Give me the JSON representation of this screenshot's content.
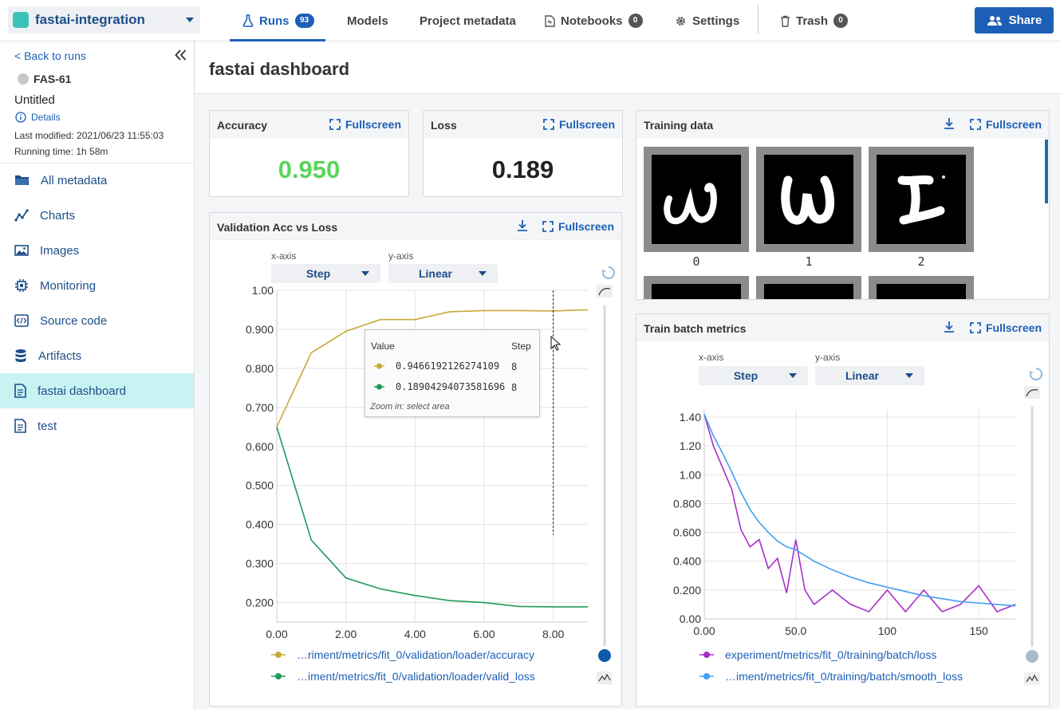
{
  "topbar": {
    "project_name": "fastai-integration",
    "tabs": [
      {
        "label": "Runs",
        "badge": "93"
      },
      {
        "label": "Models"
      },
      {
        "label": "Project metadata"
      },
      {
        "label": "Notebooks",
        "badge": "0"
      },
      {
        "label": "Settings"
      },
      {
        "label": "Trash",
        "badge": "0"
      }
    ],
    "share_label": "Share"
  },
  "sidebar": {
    "back_label": "< Back to runs",
    "run_id": "FAS-61",
    "run_name": "Untitled",
    "details_label": "Details",
    "last_modified": "Last modified: 2021/06/23 11:55:03",
    "running_time": "Running time: 1h 58m",
    "items": [
      {
        "label": "All metadata",
        "icon": "folder-icon"
      },
      {
        "label": "Charts",
        "icon": "chart-icon"
      },
      {
        "label": "Images",
        "icon": "image-icon"
      },
      {
        "label": "Monitoring",
        "icon": "chip-icon"
      },
      {
        "label": "Source code",
        "icon": "code-icon"
      },
      {
        "label": "Artifacts",
        "icon": "database-icon"
      },
      {
        "label": "fastai dashboard",
        "icon": "document-icon",
        "active": true
      },
      {
        "label": "test",
        "icon": "document-icon"
      }
    ]
  },
  "main": {
    "title": "fastai dashboard",
    "fullscreen_label": "Fullscreen",
    "accuracy": {
      "title": "Accuracy",
      "value": "0.950",
      "color": "#5bd35b"
    },
    "loss": {
      "title": "Loss",
      "value": "0.189"
    },
    "training_data": {
      "title": "Training data",
      "labels": [
        "0",
        "1",
        "2"
      ]
    },
    "val_chart": {
      "title": "Validation Acc vs Loss",
      "xaxis_label": "x-axis",
      "xaxis_value": "Step",
      "yaxis_label": "y-axis",
      "yaxis_value": "Linear",
      "tooltip": {
        "value_header": "Value",
        "step_header": "Step",
        "rows": [
          {
            "value": "0.9466192126274109",
            "step": "8",
            "color": "#c8a83a"
          },
          {
            "value": "0.18904294073581696",
            "step": "8",
            "color": "#219a5a"
          }
        ],
        "footer": "Zoom in: select area"
      },
      "legend": [
        "…riment/metrics/fit_0/validation/loader/accuracy",
        "…iment/metrics/fit_0/validation/loader/valid_loss"
      ]
    },
    "batch_chart": {
      "title": "Train batch metrics",
      "xaxis_label": "x-axis",
      "xaxis_value": "Step",
      "yaxis_label": "y-axis",
      "yaxis_value": "Linear",
      "legend": [
        "experiment/metrics/fit_0/training/batch/loss",
        "…iment/metrics/fit_0/training/batch/smooth_loss"
      ]
    }
  },
  "chart_data": [
    {
      "type": "line",
      "title": "Validation Acc vs Loss",
      "xlim": [
        0,
        9
      ],
      "ylim": [
        0.15,
        1.0
      ],
      "x_ticks": [
        "0.00",
        "2.00",
        "4.00",
        "6.00",
        "8.00"
      ],
      "y_ticks": [
        "1.00",
        "0.900",
        "0.800",
        "0.700",
        "0.600",
        "0.500",
        "0.400",
        "0.300",
        "0.200"
      ],
      "x": [
        0,
        1,
        2,
        3,
        4,
        5,
        6,
        7,
        8,
        9
      ],
      "series": [
        {
          "name": "…riment/metrics/fit_0/validation/loader/accuracy",
          "color": "#c8a83a",
          "values": [
            0.65,
            0.84,
            0.895,
            0.925,
            0.925,
            0.945,
            0.948,
            0.948,
            0.947,
            0.95
          ]
        },
        {
          "name": "…iment/metrics/fit_0/validation/loader/valid_loss",
          "color": "#219a5a",
          "values": [
            0.65,
            0.36,
            0.263,
            0.235,
            0.218,
            0.205,
            0.2,
            0.19,
            0.189,
            0.189
          ]
        }
      ],
      "grid": true
    },
    {
      "type": "line",
      "title": "Train batch metrics",
      "xlim": [
        0,
        170
      ],
      "ylim": [
        0,
        1.45
      ],
      "x_ticks": [
        "0.00",
        "50.0",
        "100",
        "150"
      ],
      "y_ticks": [
        "1.40",
        "1.20",
        "1.00",
        "0.800",
        "0.600",
        "0.400",
        "0.200",
        "0.00"
      ],
      "x": [
        0,
        5,
        10,
        15,
        20,
        25,
        30,
        35,
        40,
        45,
        50,
        55,
        60,
        70,
        80,
        90,
        100,
        110,
        120,
        130,
        140,
        150,
        160,
        170
      ],
      "series": [
        {
          "name": "experiment/metrics/fit_0/training/batch/loss",
          "color": "#a72fc9",
          "values": [
            1.42,
            1.2,
            1.05,
            0.9,
            0.62,
            0.5,
            0.55,
            0.35,
            0.42,
            0.18,
            0.55,
            0.2,
            0.1,
            0.2,
            0.1,
            0.05,
            0.2,
            0.05,
            0.2,
            0.05,
            0.1,
            0.23,
            0.05,
            0.1
          ]
        },
        {
          "name": "…iment/metrics/fit_0/training/batch/smooth_loss",
          "color": "#3f9ff0",
          "values": [
            1.42,
            1.27,
            1.15,
            1.02,
            0.88,
            0.76,
            0.67,
            0.6,
            0.54,
            0.5,
            0.48,
            0.44,
            0.4,
            0.34,
            0.29,
            0.25,
            0.22,
            0.19,
            0.16,
            0.14,
            0.12,
            0.11,
            0.1,
            0.09
          ]
        }
      ],
      "grid": true
    }
  ]
}
